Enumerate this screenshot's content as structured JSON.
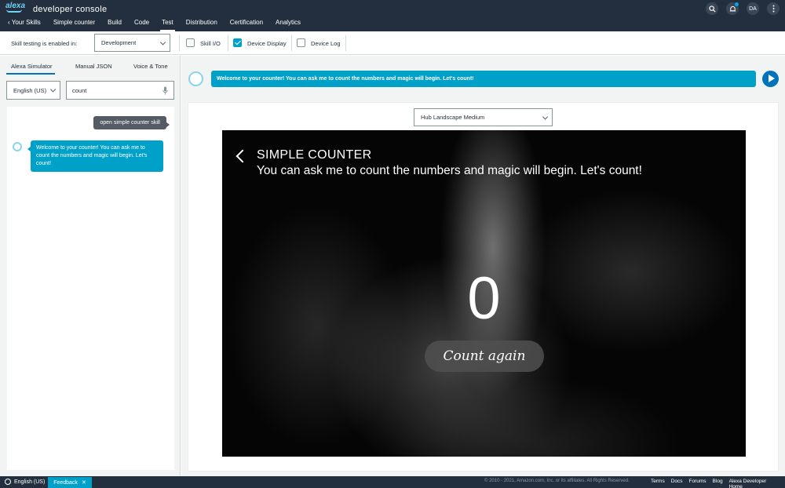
{
  "header": {
    "logo_text": "alexa",
    "console_title": "developer console",
    "nav": [
      {
        "label": "Your Skills"
      },
      {
        "label": "Simple counter"
      },
      {
        "label": "Build"
      },
      {
        "label": "Code"
      },
      {
        "label": "Test"
      },
      {
        "label": "Distribution"
      },
      {
        "label": "Certification"
      },
      {
        "label": "Analytics"
      }
    ],
    "active_nav": "Test",
    "avatar_initials": "DA"
  },
  "toolbar": {
    "testing_label": "Skill testing is enabled in:",
    "stage_value": "Development",
    "checkboxes": [
      {
        "label": "Skill I/O",
        "checked": false
      },
      {
        "label": "Device Display",
        "checked": true
      },
      {
        "label": "Device Log",
        "checked": false
      }
    ]
  },
  "left_panel": {
    "tabs": [
      "Alexa Simulator",
      "Manual JSON",
      "Voice & Tone"
    ],
    "active_tab": "Alexa Simulator",
    "locale_value": "English (US)",
    "utterance_value": "count",
    "messages": {
      "user": "open simple counter skill",
      "alexa": "Welcome to your counter! You can ask me to count the numbers and magic will begin. Let's count!"
    }
  },
  "right_panel": {
    "speech_text": "Welcome to your counter! You can ask me to count the numbers and magic will begin. Let's count!",
    "device_value": "Hub Landscape Medium",
    "display": {
      "title": "SIMPLE COUNTER",
      "subtitle": "You can ask me to count the numbers and magic will begin. Let's count!",
      "count": "0",
      "button_label": "Count again"
    }
  },
  "footer": {
    "language": "English (US)",
    "feedback": "Feedback",
    "copyright": "© 2010 - 2021, Amazon.com, Inc. or its affiliates. All Rights Reserved.",
    "links": [
      "Terms",
      "Docs",
      "Forums",
      "Blog",
      "Alexa Developer Home"
    ]
  },
  "colors": {
    "nav_bg": "#232f3e",
    "accent": "#00a1c9",
    "play": "#0073bb"
  }
}
